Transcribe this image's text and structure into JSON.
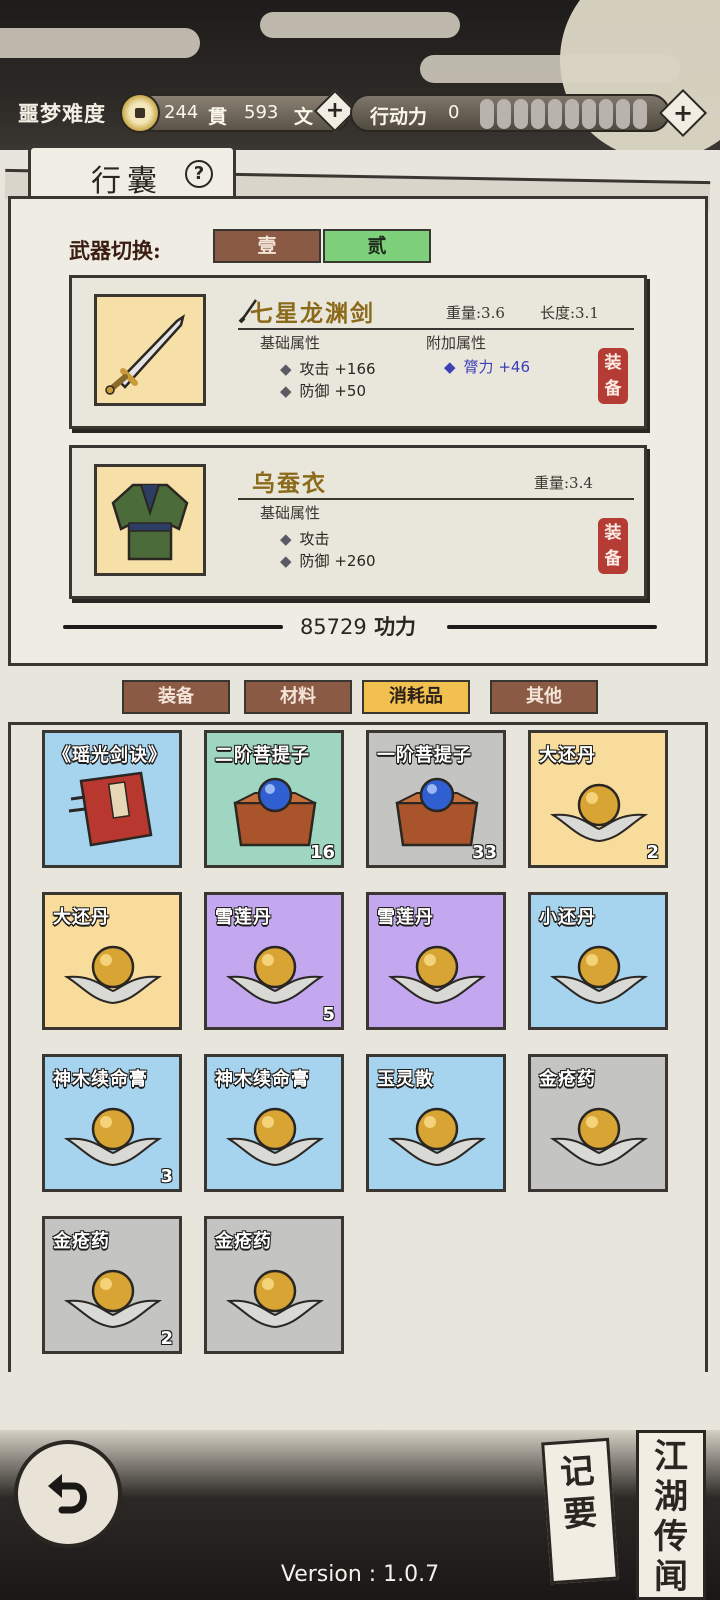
{
  "header": {
    "difficulty": "噩梦难度",
    "currency": {
      "guan_value": "244",
      "guan_unit": "貫",
      "wen_value": "593",
      "wen_unit": "文"
    },
    "stamina": {
      "label": "行动力",
      "value": "0"
    }
  },
  "bag": {
    "title": "行囊",
    "help": "?",
    "weapon_switch_label": "武器切换:",
    "switch_options": [
      "壹",
      "贰"
    ],
    "selected_switch": "贰",
    "weapon": {
      "name": "七星龙渊剑",
      "weight": "重量:3.6",
      "length": "长度:3.1",
      "base_label": "基础属性",
      "bonus_label": "附加属性",
      "attack_label": "攻击",
      "attack_value": "+166",
      "defense_label": "防御",
      "defense_value": "+50",
      "bonus_attr_label": "膂力",
      "bonus_attr_value": "+46",
      "equip_label": "装备"
    },
    "armor": {
      "name": "乌蚕衣",
      "weight": "重量:3.4",
      "base_label": "基础属性",
      "attack_label": "攻击",
      "defense_label": "防御",
      "defense_value": "+260",
      "equip_label": "装备"
    },
    "power_value": "85729",
    "power_label": "功力"
  },
  "categories": [
    {
      "label": "装备",
      "active": false
    },
    {
      "label": "材料",
      "active": false
    },
    {
      "label": "消耗品",
      "active": true
    },
    {
      "label": "其他",
      "active": false
    }
  ],
  "items": [
    {
      "name": "《瑶光剑诀》",
      "count": "",
      "bg": "blue",
      "icon": "book-icon"
    },
    {
      "name": "二阶菩提子",
      "count": "16",
      "bg": "green",
      "icon": "bodhi-chest-icon"
    },
    {
      "name": "一阶菩提子",
      "count": "33",
      "bg": "gray",
      "icon": "bodhi-chest-icon"
    },
    {
      "name": "大还丹",
      "count": "2",
      "bg": "yellow",
      "icon": "pill-icon"
    },
    {
      "name": "大还丹",
      "count": "",
      "bg": "yellow",
      "icon": "pill-icon"
    },
    {
      "name": "雪莲丹",
      "count": "5",
      "bg": "purple",
      "icon": "pill-icon"
    },
    {
      "name": "雪莲丹",
      "count": "",
      "bg": "purple",
      "icon": "pill-icon"
    },
    {
      "name": "小还丹",
      "count": "",
      "bg": "blue",
      "icon": "pill-icon"
    },
    {
      "name": "神木续命膏",
      "count": "3",
      "bg": "blue",
      "icon": "pill-icon"
    },
    {
      "name": "神木续命膏",
      "count": "",
      "bg": "blue",
      "icon": "pill-icon"
    },
    {
      "name": "玉灵散",
      "count": "",
      "bg": "blue",
      "icon": "pill-icon"
    },
    {
      "name": "金疮药",
      "count": "",
      "bg": "gray",
      "icon": "pill-icon"
    },
    {
      "name": "金疮药",
      "count": "2",
      "bg": "gray",
      "icon": "pill-icon"
    },
    {
      "name": "金疮药",
      "count": "",
      "bg": "gray",
      "icon": "pill-icon"
    }
  ],
  "bottom": {
    "notes_label": "记要",
    "rumors_label": "江湖传闻",
    "version": "Version : 1.0.7"
  },
  "colors": {
    "active_switch": "#7fd07a",
    "inactive_tab": "#8b5a45",
    "active_tab": "#f2c04f",
    "equip_stamp": "#b53c35",
    "bonus_attr": "#3c3fb6"
  }
}
